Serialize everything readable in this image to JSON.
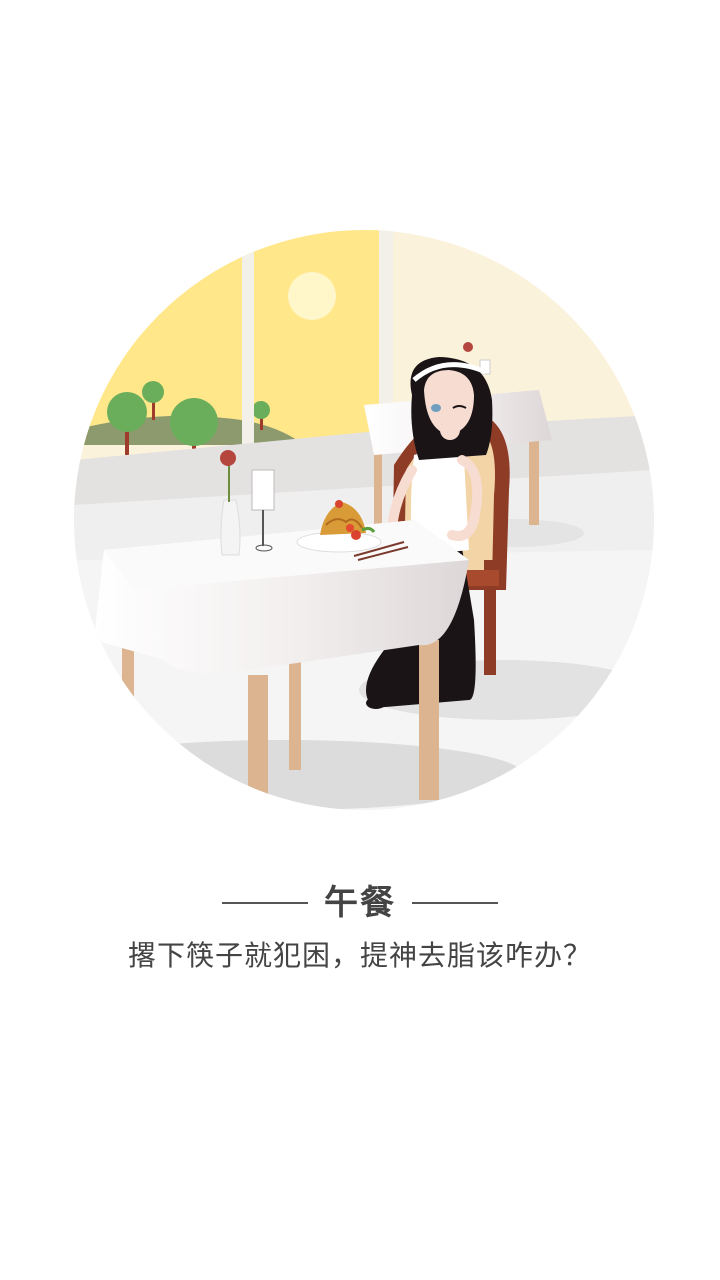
{
  "onboarding": {
    "illustration_scene": "lunch-restaurant",
    "title": "午餐",
    "subtitle": "撂下筷子就犯困，提神去脂该咋办？",
    "colors": {
      "background": "#ffffff",
      "text": "#444444",
      "window_sky": "#ffe78a",
      "wall": "#fbf2dc",
      "floor": "#f5f5f5",
      "chair": "#8f3c26",
      "table_leg": "#dcb48f"
    }
  }
}
